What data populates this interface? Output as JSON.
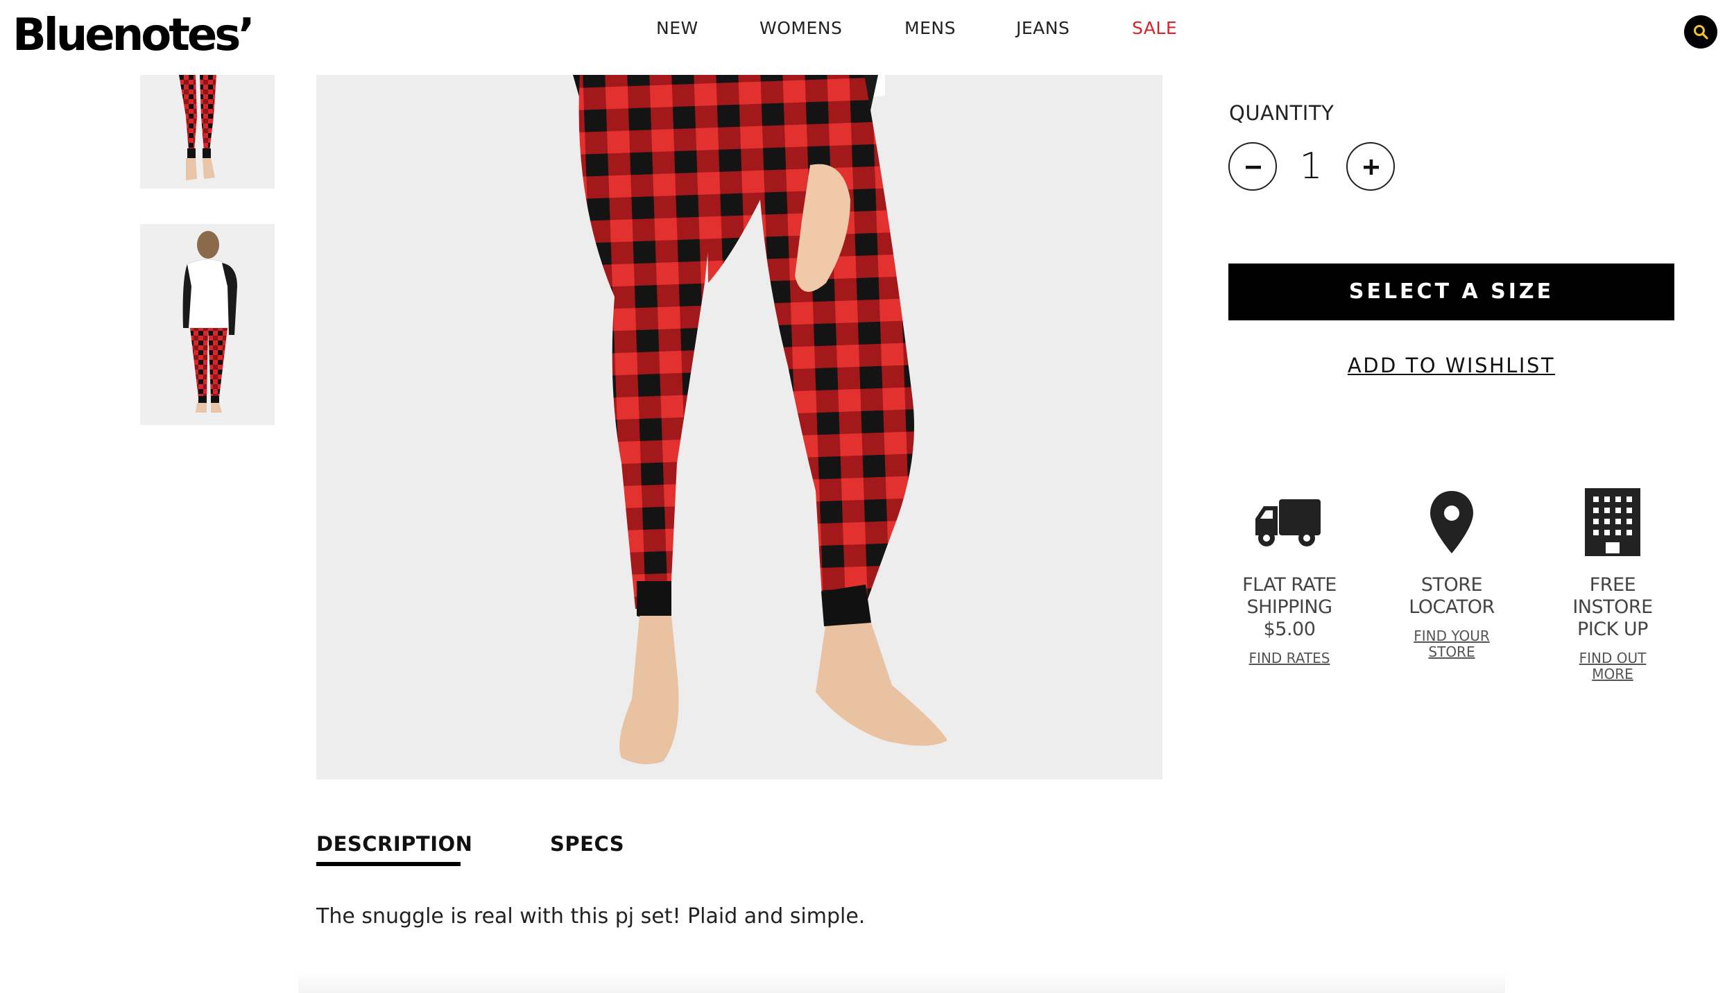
{
  "header": {
    "logo": "Bluenotes’",
    "nav": [
      "NEW",
      "WOMENS",
      "MENS",
      "JEANS",
      "SALE"
    ],
    "search_icon": "search-icon"
  },
  "gallery": {
    "thumbnails": [
      "thumbnail-pants-front",
      "thumbnail-back-view"
    ]
  },
  "product": {
    "quantity_label": "QUANTITY",
    "quantity_value": "1",
    "select_size_label": "SELECT A SIZE",
    "wishlist_label": "ADD TO WISHLIST"
  },
  "features": [
    {
      "icon": "truck-icon",
      "title_lines": [
        "FLAT RATE",
        "SHIPPING",
        "$5.00"
      ],
      "link_lines": [
        "FIND RATES"
      ]
    },
    {
      "icon": "location-pin-icon",
      "title_lines": [
        "STORE",
        "LOCATOR"
      ],
      "link_lines": [
        "FIND YOUR",
        "STORE"
      ]
    },
    {
      "icon": "building-icon",
      "title_lines": [
        "FREE",
        "INSTORE",
        "PICK UP"
      ],
      "link_lines": [
        "FIND OUT",
        "MORE"
      ]
    }
  ],
  "tabs": {
    "description_label": "DESCRIPTION",
    "specs_label": "SPECS",
    "description_text": "The snuggle is real with this pj set! Plaid and simple."
  },
  "colors": {
    "sale": "#d6232a",
    "plaid_red": "#d8262b",
    "plaid_black": "#111111",
    "search_glyph": "#f2c230"
  }
}
